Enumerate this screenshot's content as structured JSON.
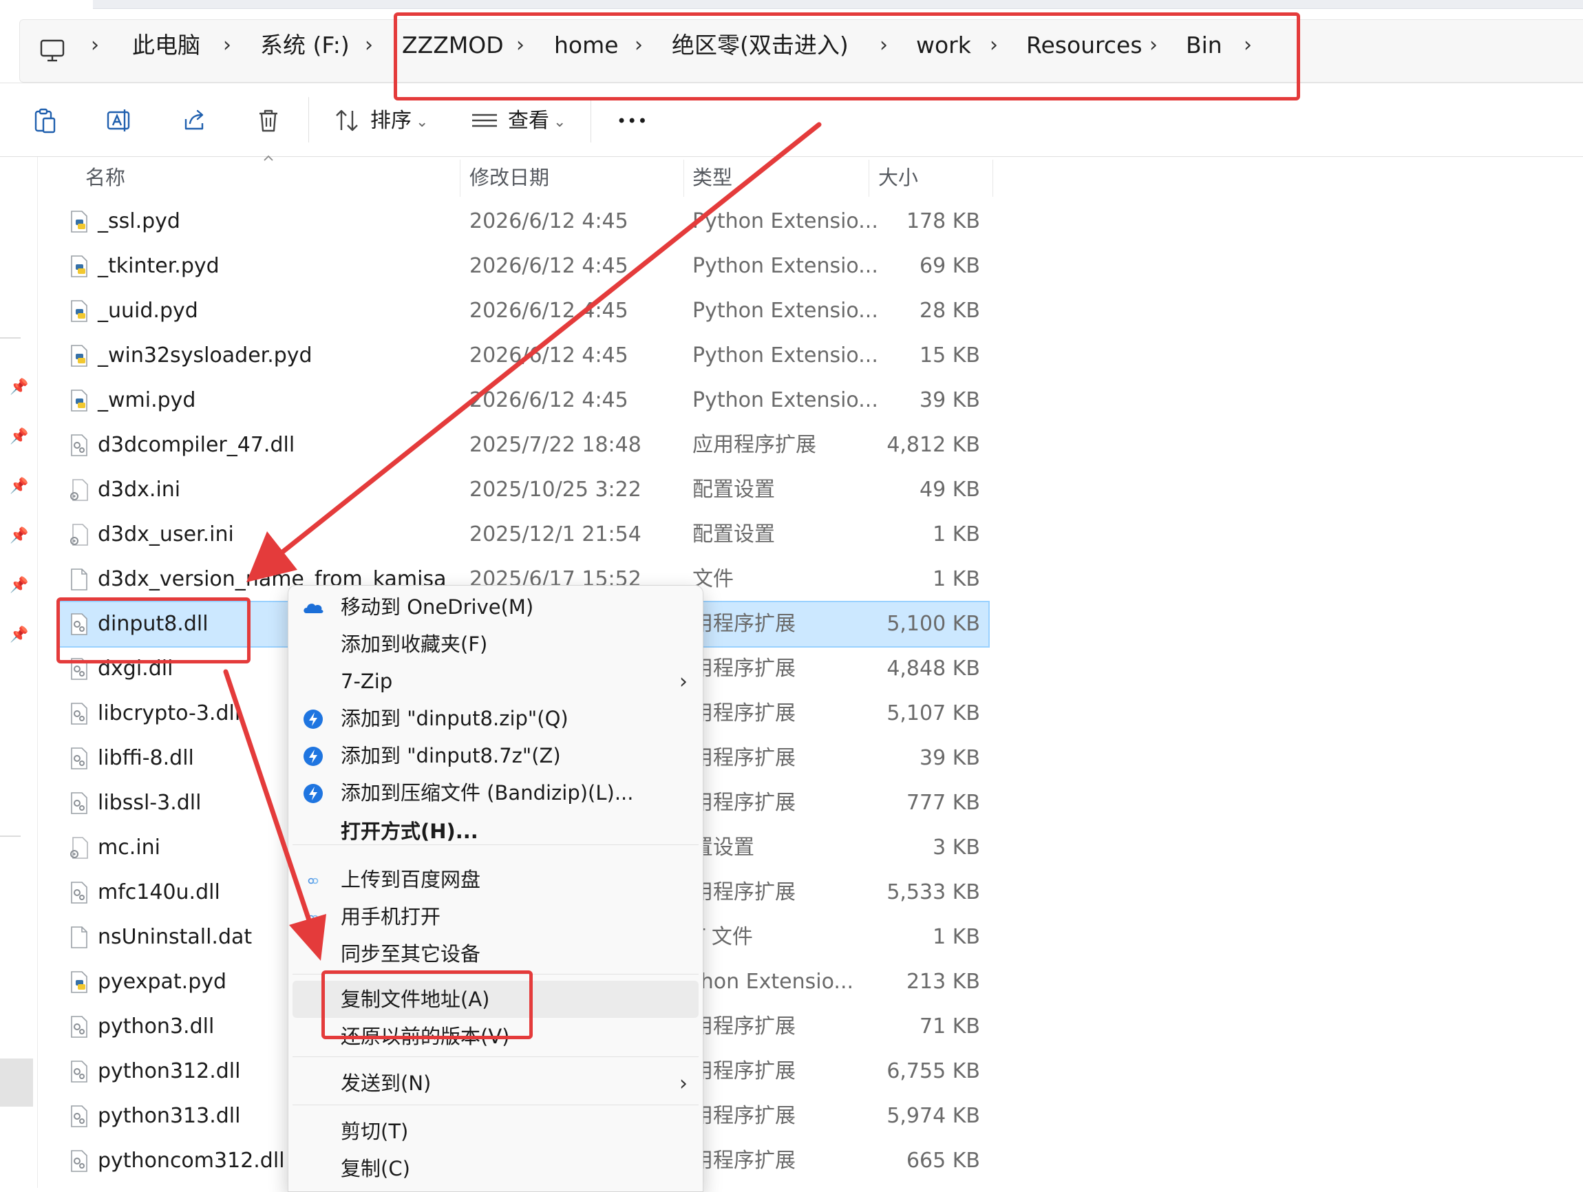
{
  "breadcrumb": [
    "此电脑",
    "系统 (F:)",
    "ZZZMOD",
    "home",
    "绝区零(双击进入)",
    "work",
    "Resources",
    "Bin"
  ],
  "toolbar": {
    "sort_label": "排序",
    "view_label": "查看",
    "more_label": "•••",
    "dropdown_glyph": "⌄"
  },
  "columns": {
    "name": "名称",
    "date": "修改日期",
    "type": "类型",
    "size": "大小"
  },
  "files": [
    {
      "name": "_ssl.pyd",
      "date": "2026/6/12 4:45",
      "type": "Python Extensio...",
      "size": "178 KB",
      "icon": "python-file-icon"
    },
    {
      "name": "_tkinter.pyd",
      "date": "2026/6/12 4:45",
      "type": "Python Extensio...",
      "size": "69 KB",
      "icon": "python-file-icon"
    },
    {
      "name": "_uuid.pyd",
      "date": "2026/6/12 4:45",
      "type": "Python Extensio...",
      "size": "28 KB",
      "icon": "python-file-icon"
    },
    {
      "name": "_win32sysloader.pyd",
      "date": "2026/6/12 4:45",
      "type": "Python Extensio...",
      "size": "15 KB",
      "icon": "python-file-icon"
    },
    {
      "name": "_wmi.pyd",
      "date": "2026/6/12 4:45",
      "type": "Python Extensio...",
      "size": "39 KB",
      "icon": "python-file-icon"
    },
    {
      "name": "d3dcompiler_47.dll",
      "date": "2025/7/22 18:48",
      "type": "应用程序扩展",
      "size": "4,812 KB",
      "icon": "dll-file-icon"
    },
    {
      "name": "d3dx.ini",
      "date": "2025/10/25 3:22",
      "type": "配置设置",
      "size": "49 KB",
      "icon": "ini-file-icon"
    },
    {
      "name": "d3dx_user.ini",
      "date": "2025/12/1 21:54",
      "type": "配置设置",
      "size": "1 KB",
      "icon": "ini-file-icon"
    },
    {
      "name": "d3dx_version_name_from_kamisa",
      "date": "2025/6/17 15:52",
      "type": "文件",
      "size": "1 KB",
      "icon": "blank-file-icon"
    },
    {
      "name": "dinput8.dll",
      "date": "",
      "type": "用程序扩展",
      "size": "5,100 KB",
      "icon": "dll-file-icon",
      "selected": true
    },
    {
      "name": "dxgi.dll",
      "date": "",
      "type": "用程序扩展",
      "size": "4,848 KB",
      "icon": "dll-file-icon"
    },
    {
      "name": "libcrypto-3.dll",
      "date": "",
      "type": "用程序扩展",
      "size": "5,107 KB",
      "icon": "dll-file-icon"
    },
    {
      "name": "libffi-8.dll",
      "date": "",
      "type": "用程序扩展",
      "size": "39 KB",
      "icon": "dll-file-icon"
    },
    {
      "name": "libssl-3.dll",
      "date": "",
      "type": "用程序扩展",
      "size": "777 KB",
      "icon": "dll-file-icon"
    },
    {
      "name": "mc.ini",
      "date": "",
      "type": "置设置",
      "size": "3 KB",
      "icon": "ini-file-icon"
    },
    {
      "name": "mfc140u.dll",
      "date": "",
      "type": "用程序扩展",
      "size": "5,533 KB",
      "icon": "dll-file-icon"
    },
    {
      "name": "nsUninstall.dat",
      "date": "",
      "type": "T 文件",
      "size": "1 KB",
      "icon": "blank-file-icon"
    },
    {
      "name": "pyexpat.pyd",
      "date": "",
      "type": "thon Extensio...",
      "size": "213 KB",
      "icon": "python-file-icon"
    },
    {
      "name": "python3.dll",
      "date": "",
      "type": "用程序扩展",
      "size": "71 KB",
      "icon": "dll-file-icon"
    },
    {
      "name": "python312.dll",
      "date": "",
      "type": "用程序扩展",
      "size": "6,755 KB",
      "icon": "dll-file-icon"
    },
    {
      "name": "python313.dll",
      "date": "",
      "type": "用程序扩展",
      "size": "5,974 KB",
      "icon": "dll-file-icon"
    },
    {
      "name": "pythoncom312.dll",
      "date": "",
      "type": "用程序扩展",
      "size": "665 KB",
      "icon": "dll-file-icon"
    }
  ],
  "context_menu": [
    {
      "label": "移动到 OneDrive(M)",
      "icon": "onedrive-icon"
    },
    {
      "label": "添加到收藏夹(F)",
      "icon": ""
    },
    {
      "label": "7-Zip",
      "icon": "",
      "submenu": true
    },
    {
      "label": "添加到 \"dinput8.zip\"(Q)",
      "icon": "bandizip-icon"
    },
    {
      "label": "添加到 \"dinput8.7z\"(Z)",
      "icon": "bandizip-icon"
    },
    {
      "label": "添加到压缩文件 (Bandizip)(L)...",
      "icon": "bandizip-icon"
    },
    {
      "label": "打开方式(H)...",
      "icon": "",
      "bold": true
    },
    {
      "label": "上传到百度网盘",
      "icon": "baidu-netdisk-icon"
    },
    {
      "label": "用手机打开",
      "icon": "baidu-netdisk-icon"
    },
    {
      "label": "同步至其它设备",
      "icon": ""
    },
    {
      "label": "复制文件地址(A)",
      "icon": "",
      "highlighted": true
    },
    {
      "label": "还原以前的版本(V)",
      "icon": ""
    },
    {
      "label": "发送到(N)",
      "icon": "",
      "submenu": true
    },
    {
      "label": "剪切(T)",
      "icon": ""
    },
    {
      "label": "复制(C)",
      "icon": ""
    }
  ],
  "submenu_arrow": "›",
  "colors": {
    "annotation_red": "#e43b3b",
    "selection_bg": "#cce8ff",
    "onedrive_blue": "#1c6fd8",
    "bandizip_blue": "#1f75e0"
  }
}
